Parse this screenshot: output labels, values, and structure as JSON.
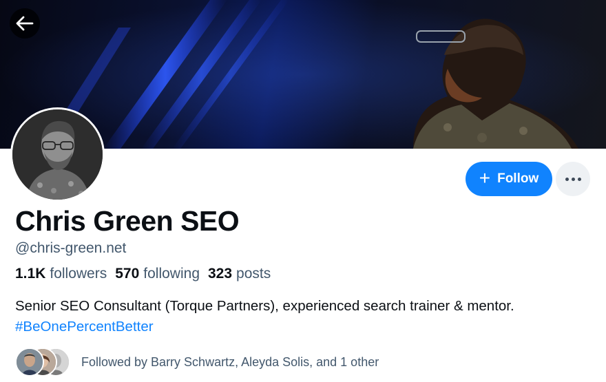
{
  "banner": {
    "alt": "Profile banner of a man speaking on stage with blue lights"
  },
  "nav": {
    "back_icon": "arrow-left-icon"
  },
  "profile": {
    "display_name": "Chris Green SEO",
    "handle": "@chris-green.net",
    "followers_count": "1.1K",
    "followers_label": "followers",
    "following_count": "570",
    "following_label": "following",
    "posts_count": "323",
    "posts_label": "posts",
    "bio": "Senior SEO Consultant (Torque Partners), experienced search trainer & mentor.",
    "hashtag": "#BeOnePercentBetter"
  },
  "actions": {
    "follow_label": "Follow",
    "follow_icon": "plus-icon",
    "more_icon": "ellipsis-icon"
  },
  "followed_by": {
    "text": "Followed by Barry Schwartz, Aleyda Solis, and 1 other"
  },
  "colors": {
    "accent": "#1083fe",
    "muted_text": "#42576c",
    "primary_text": "#0b0f14",
    "more_button_bg": "#eef1f4"
  }
}
